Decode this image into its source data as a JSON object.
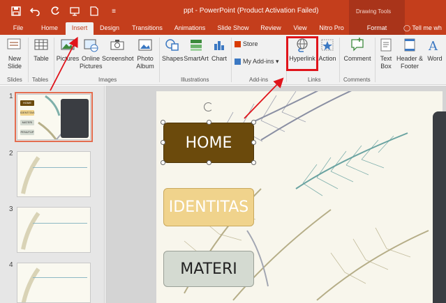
{
  "window": {
    "title": "ppt - PowerPoint (Product Activation Failed)",
    "context_title": "Drawing Tools"
  },
  "tabs": [
    {
      "label": "File"
    },
    {
      "label": "Home"
    },
    {
      "label": "Insert"
    },
    {
      "label": "Design"
    },
    {
      "label": "Transitions"
    },
    {
      "label": "Animations"
    },
    {
      "label": "Slide Show"
    },
    {
      "label": "Review"
    },
    {
      "label": "View"
    },
    {
      "label": "Nitro Pro"
    },
    {
      "label": "Format"
    }
  ],
  "tell_me": "Tell me wh",
  "ribbon": {
    "new_slide": "New Slide",
    "table": "Table",
    "pictures": "Pictures",
    "online_pictures": "Online Pictures",
    "screenshot": "Screenshot",
    "photo_album": "Photo Album",
    "shapes": "Shapes",
    "smartart": "SmartArt",
    "chart": "Chart",
    "store": "Store",
    "my_addins": "My Add-ins",
    "hyperlink": "Hyperlink",
    "action": "Action",
    "comment": "Comment",
    "text_box": "Text Box",
    "header_footer": "Header & Footer",
    "wordart": "Word",
    "groups": {
      "slides": "Slides",
      "tables": "Tables",
      "images": "Images",
      "illustrations": "Illustrations",
      "addins": "Add-ins",
      "links": "Links",
      "comments": "Comments"
    }
  },
  "slides_panel": {
    "numbers": [
      "1",
      "2",
      "3",
      "4"
    ],
    "thumb1": {
      "home": "HOME",
      "identitas": "IDENTITAS",
      "materi": "MATERI",
      "penutup": "PENUTUP"
    }
  },
  "slide": {
    "home": "HOME",
    "identitas": "IDENTITAS",
    "materi": "MATERI"
  },
  "colors": {
    "accent": "#c43e1c",
    "home_fill": "#6b4a0c",
    "identitas_fill": "#f0d38c",
    "materi_fill": "#d4dad1",
    "annotation_red": "#e0141b"
  }
}
